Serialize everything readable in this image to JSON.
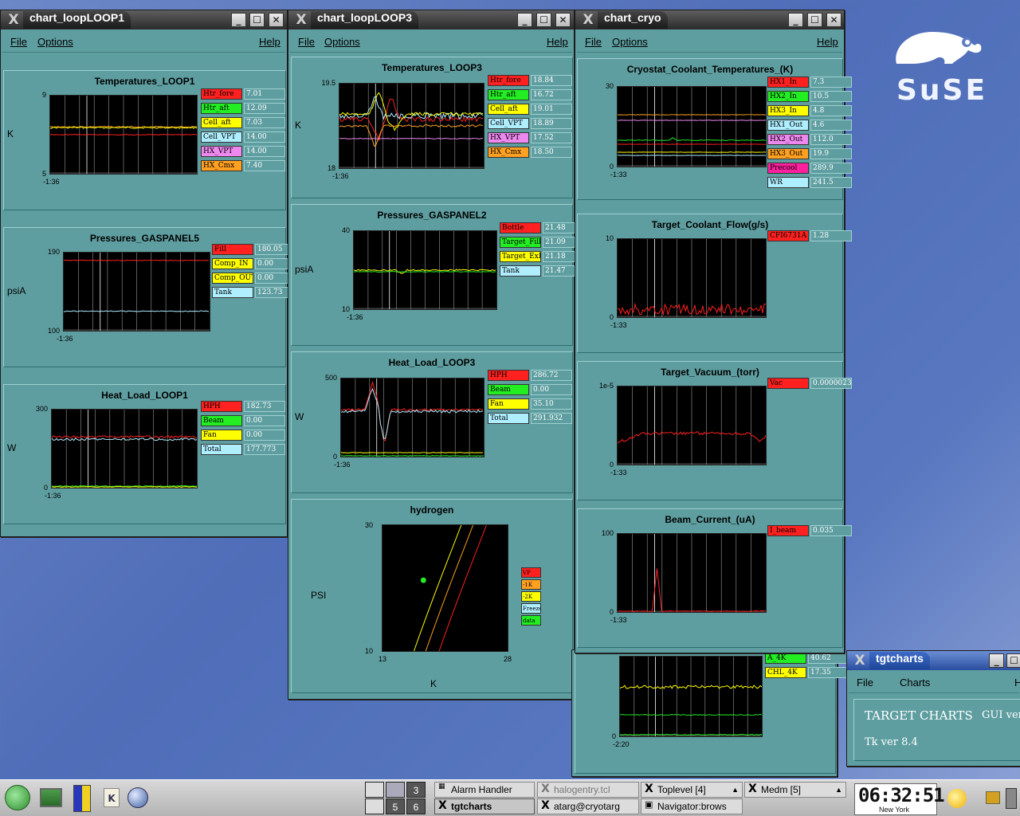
{
  "desktop": {
    "brand": "SuSE"
  },
  "windows": {
    "loop1": {
      "title": "chart_loopLOOP1",
      "menu": {
        "file": "File",
        "options": "Options",
        "help": "Help"
      }
    },
    "loop3": {
      "title": "chart_loopLOOP3",
      "menu": {
        "file": "File",
        "options": "Options",
        "help": "Help"
      }
    },
    "cryo": {
      "title": "chart_cryo",
      "menu": {
        "file": "File",
        "options": "Options",
        "help": "Help"
      }
    },
    "tgt": {
      "title": "tgtcharts",
      "menu": {
        "file": "File",
        "charts": "Charts",
        "help": "H"
      },
      "heading": "TARGET CHARTS",
      "gui": "GUI ver",
      "tk": "Tk ver 8.4"
    }
  },
  "charts": {
    "temp1": {
      "title": "Temperatures_LOOP1",
      "ylabel": "K",
      "ymax": "9",
      "ymin": "5",
      "xtick": "-1:36",
      "legend": [
        {
          "name": "Htr_fore",
          "value": "7.01",
          "color": "#ff2020"
        },
        {
          "name": "Htr_aft",
          "value": "12.09",
          "color": "#22ee22"
        },
        {
          "name": "Cell_aft",
          "value": "7.03",
          "color": "#ffff00"
        },
        {
          "name": "Cell_VPT",
          "value": "14.00",
          "color": "#aeeeff"
        },
        {
          "name": "HX_VPT",
          "value": "14.00",
          "color": "#ee88ee"
        },
        {
          "name": "HX_Cmx",
          "value": "7.40",
          "color": "#ffa020"
        }
      ]
    },
    "press5": {
      "title": "Pressures_GASPANEL5",
      "ylabel": "psiA",
      "ymax": "190",
      "ymin": "100",
      "xtick": "-1:36",
      "legend": [
        {
          "name": "Fill",
          "value": "180.05",
          "color": "#ff2020"
        },
        {
          "name": "Comp_IN",
          "value": "0.00",
          "color": "#ffff00"
        },
        {
          "name": "Comp_OUT",
          "value": "0.00",
          "color": "#ffff00"
        },
        {
          "name": "Tank",
          "value": "123.73",
          "color": "#aeeeff"
        }
      ]
    },
    "heat1": {
      "title": "Heat_Load_LOOP1",
      "ylabel": "W",
      "ymax": "300",
      "ymin": "0",
      "xtick": "-1:36",
      "legend": [
        {
          "name": "HPH",
          "value": "182.73",
          "color": "#ff2020"
        },
        {
          "name": "Beam",
          "value": "0.00",
          "color": "#22ee22"
        },
        {
          "name": "Fan",
          "value": "0.00",
          "color": "#ffff00"
        },
        {
          "name": "Total",
          "value": "177.773",
          "color": "#aeeeff"
        }
      ]
    },
    "temp3": {
      "title": "Temperatures_LOOP3",
      "ylabel": "K",
      "ymax": "19.5",
      "ymin": "18",
      "xtick": "-1:36",
      "legend": [
        {
          "name": "Htr_fore",
          "value": "18.84",
          "color": "#ff2020"
        },
        {
          "name": "Htr_aft",
          "value": "16.72",
          "color": "#22ee22"
        },
        {
          "name": "Cell_aft",
          "value": "19.01",
          "color": "#ffff00"
        },
        {
          "name": "Cell_VPT",
          "value": "18.89",
          "color": "#aeeeff"
        },
        {
          "name": "HX_VPT",
          "value": "17.52",
          "color": "#ee88ee"
        },
        {
          "name": "HX_Cmx",
          "value": "18.50",
          "color": "#ffa020"
        }
      ]
    },
    "press2": {
      "title": "Pressures_GASPANEL2",
      "ylabel": "psiA",
      "ymax": "40",
      "ymin": "10",
      "xtick": "-1:36",
      "legend": [
        {
          "name": "Bottle",
          "value": "21.48",
          "color": "#ff2020"
        },
        {
          "name": "Target_Fill",
          "value": "21.09",
          "color": "#22ee22"
        },
        {
          "name": "Target_Exh",
          "value": "21.18",
          "color": "#ffff00"
        },
        {
          "name": "Tank",
          "value": "21.47",
          "color": "#aeeeff"
        }
      ]
    },
    "heat3": {
      "title": "Heat_Load_LOOP3",
      "ylabel": "W",
      "ymax": "500",
      "ymin": "0",
      "xtick": "-1:36",
      "legend": [
        {
          "name": "HPH",
          "value": "286.72",
          "color": "#ff2020"
        },
        {
          "name": "Beam",
          "value": "0.00",
          "color": "#22ee22"
        },
        {
          "name": "Fan",
          "value": "35.10",
          "color": "#ffff00"
        },
        {
          "name": "Total",
          "value": "291.932",
          "color": "#aeeeff"
        }
      ]
    },
    "hydro": {
      "title": "hydrogen",
      "ylabel": "PSI",
      "xlabel": "K",
      "ymax": "30",
      "ymin": "10",
      "xmin": "13",
      "xmax": "28",
      "legend": [
        {
          "name": "VP",
          "color": "#ff2020"
        },
        {
          "name": "-1K",
          "color": "#ffa020"
        },
        {
          "name": "-2K",
          "color": "#ffff00"
        },
        {
          "name": "Freeze",
          "color": "#aeeeff"
        },
        {
          "name": "data",
          "color": "#22ee22"
        }
      ]
    },
    "cryo": {
      "title": "Cryostat_Coolant_Temperatures_(K)",
      "ymax": "30",
      "ymin": "0",
      "xtick": "-1:33",
      "legend": [
        {
          "name": "HX1_In",
          "value": "7.3",
          "color": "#ff2020"
        },
        {
          "name": "HX2_In",
          "value": "10.5",
          "color": "#22ee22"
        },
        {
          "name": "HX3_In",
          "value": "4.8",
          "color": "#ffff00"
        },
        {
          "name": "HX1_Out",
          "value": "4.6",
          "color": "#aeeeff"
        },
        {
          "name": "HX2_Out",
          "value": "112.0",
          "color": "#ee88ee"
        },
        {
          "name": "HX3_Out",
          "value": "19.9",
          "color": "#ffa020"
        },
        {
          "name": "Precool",
          "value": "289.9",
          "color": "#ff20a0"
        },
        {
          "name": "WR",
          "value": "241.5",
          "color": "#aeeeff"
        }
      ]
    },
    "flow": {
      "title": "Target_Coolant_Flow(g/s)",
      "ymax": "10",
      "ymin": "0",
      "xtick": "-1:33",
      "legend": [
        {
          "name": "CFI6731A",
          "value": "1.28",
          "color": "#ff2020"
        }
      ]
    },
    "vac": {
      "title": "Target_Vacuum_(torr)",
      "ymax": "1e-5",
      "ymin": "0",
      "xtick": "-1:33",
      "legend": [
        {
          "name": "Vac",
          "value": "0.0000023",
          "color": "#ff2020"
        }
      ]
    },
    "beam": {
      "title": "Beam_Current_(uA)",
      "ymax": "100",
      "ymin": "0",
      "xtick": "-1:33",
      "legend": [
        {
          "name": "I_beam",
          "value": "0.035",
          "color": "#ff2020"
        }
      ]
    },
    "hidden": {
      "ymin": "0",
      "xtick": "-2:20",
      "legend": [
        {
          "name": "A_4K",
          "value": "40.62",
          "color": "#22ee22"
        },
        {
          "name": "CHL_4K",
          "value": "17.35",
          "color": "#ffff00"
        }
      ]
    }
  },
  "taskbar": {
    "tasks": [
      "Alarm Handler",
      "halogentry.tcl",
      "Toplevel [4]",
      "Medm [5]",
      "tgtcharts",
      "atarg@cryotarg",
      "Navigator:brows"
    ],
    "pager": [
      "3",
      "5",
      "6"
    ],
    "clock": "06:32:51",
    "city": "New York"
  }
}
